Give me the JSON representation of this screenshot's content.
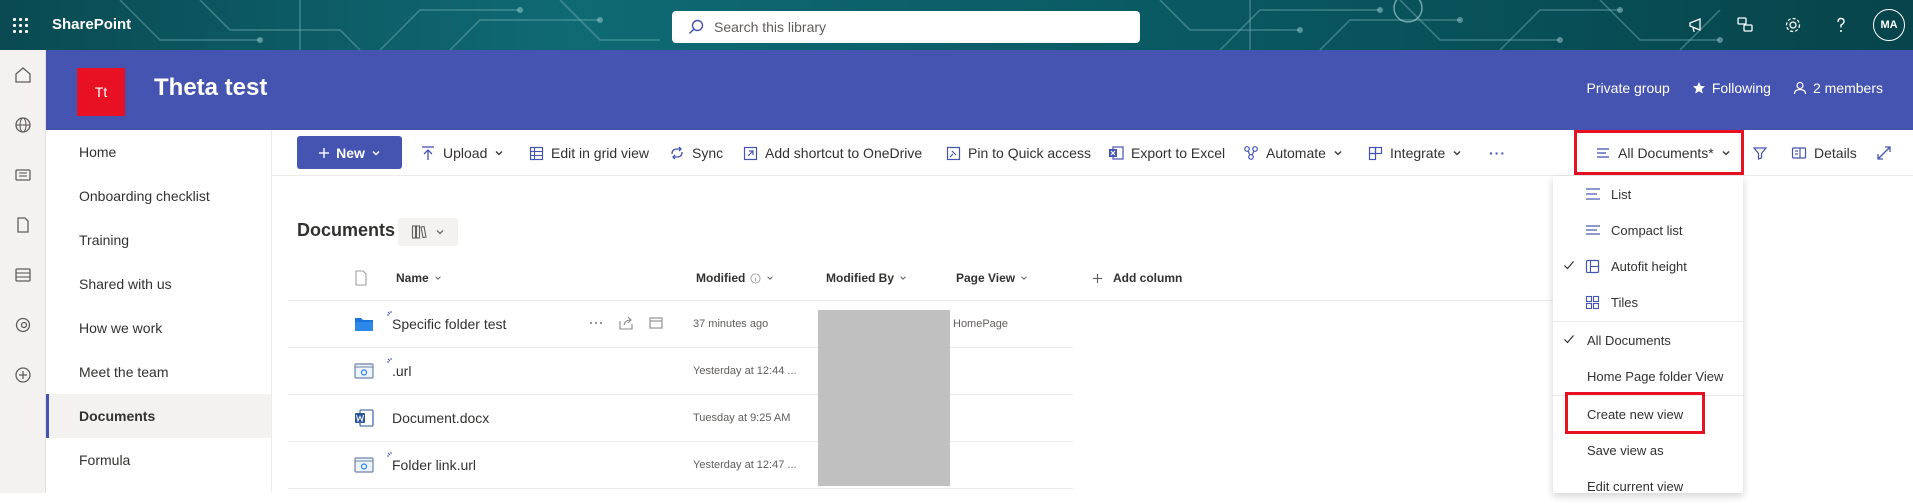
{
  "suite_bar": {
    "brand": "SharePoint",
    "search_placeholder": "Search this library",
    "avatar_initials": "MA"
  },
  "site": {
    "logo_text": "Tt",
    "title": "Theta test",
    "privacy": "Private group",
    "following": "Following",
    "members": "2 members"
  },
  "nav": {
    "items": [
      {
        "label": "Home"
      },
      {
        "label": "Onboarding checklist"
      },
      {
        "label": "Training"
      },
      {
        "label": "Shared with us"
      },
      {
        "label": "How we work"
      },
      {
        "label": "Meet the team"
      },
      {
        "label": "Documents",
        "selected": true
      },
      {
        "label": "Formula"
      }
    ]
  },
  "toolbar": {
    "new": "New",
    "upload": "Upload",
    "edit_grid": "Edit in grid view",
    "sync": "Sync",
    "shortcut": "Add shortcut to OneDrive",
    "pin": "Pin to Quick access",
    "export": "Export to Excel",
    "automate": "Automate",
    "integrate": "Integrate",
    "more": "···",
    "view": "All Documents*",
    "details": "Details"
  },
  "library": {
    "title": "Documents",
    "columns": {
      "name": "Name",
      "modified": "Modified",
      "modified_by": "Modified By",
      "page_view": "Page View",
      "add_column": "Add column"
    },
    "rows": [
      {
        "name": "Specific folder test",
        "modified": "37 minutes ago",
        "page_view": "HomePage",
        "type": "folder"
      },
      {
        "name": ".url",
        "modified": "Yesterday at 12:44 ...",
        "page_view": "",
        "type": "link"
      },
      {
        "name": "Document.docx",
        "modified": "Tuesday at 9:25 AM",
        "page_view": "",
        "type": "word"
      },
      {
        "name": "Folder link.url",
        "modified": "Yesterday at 12:47 ...",
        "page_view": "",
        "type": "link"
      }
    ]
  },
  "view_menu": {
    "list": "List",
    "compact_list": "Compact list",
    "autofit_height": "Autofit height",
    "tiles": "Tiles",
    "all_documents": "All Documents",
    "home_page_folder_view": "Home Page folder View",
    "create_new_view": "Create new view",
    "save_view_as": "Save view as",
    "edit_current_view": "Edit current view"
  },
  "colors": {
    "suite_bar": "#0f6a74",
    "site_header": "#4553b1",
    "logo": "#e81123",
    "highlight_box": "#e81123",
    "accent": "#4553b1"
  }
}
